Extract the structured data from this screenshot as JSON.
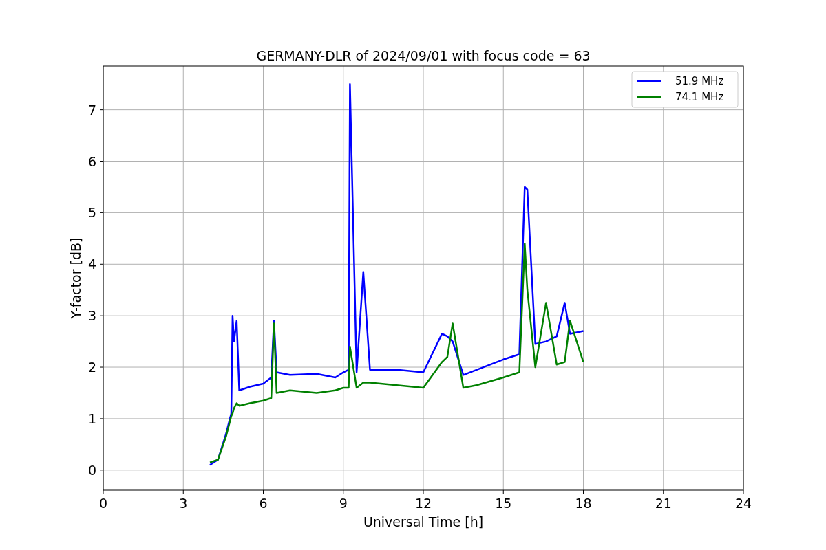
{
  "figure": {
    "chart_data": {
      "type": "line",
      "title": "GERMANY-DLR of 2024/09/01 with focus code = 63",
      "xlabel": "Universal Time [h]",
      "ylabel": "Y-factor [dB]",
      "xlim": [
        0,
        24
      ],
      "ylim": [
        -0.39,
        7.85
      ],
      "grid": true,
      "legend": true,
      "xticks": [
        0,
        3,
        6,
        9,
        12,
        15,
        18,
        21,
        24
      ],
      "yticks": [
        0,
        1,
        2,
        3,
        4,
        5,
        6,
        7
      ],
      "x": [
        4.0,
        4.3,
        4.6,
        4.8,
        4.85,
        4.9,
        5.0,
        5.1,
        5.5,
        6.0,
        6.3,
        6.4,
        6.5,
        7.0,
        8.0,
        8.7,
        9.0,
        9.2,
        9.25,
        9.5,
        9.75,
        10,
        11,
        12,
        12.7,
        12.9,
        13.1,
        13.5,
        14,
        15,
        15.6,
        15.8,
        15.9,
        16.2,
        16.6,
        17,
        17.3,
        17.5,
        18
      ],
      "series": [
        {
          "name": "51.9 MHz",
          "color": "#0000ff",
          "values": [
            0.1,
            0.2,
            0.7,
            1.1,
            3.0,
            2.5,
            2.9,
            1.55,
            1.62,
            1.68,
            1.8,
            2.9,
            1.9,
            1.85,
            1.87,
            1.8,
            1.9,
            1.95,
            7.5,
            1.9,
            3.85,
            1.95,
            1.95,
            1.9,
            2.65,
            2.6,
            2.5,
            1.85,
            1.95,
            2.15,
            2.25,
            5.5,
            5.45,
            2.45,
            2.5,
            2.6,
            3.25,
            2.65,
            2.7
          ]
        },
        {
          "name": "74.1 MHz",
          "color": "#008000",
          "values": [
            0.15,
            0.2,
            0.65,
            1.05,
            1.1,
            1.2,
            1.3,
            1.25,
            1.3,
            1.35,
            1.4,
            2.85,
            1.5,
            1.55,
            1.5,
            1.55,
            1.6,
            1.6,
            2.4,
            1.6,
            1.7,
            1.7,
            1.65,
            1.6,
            2.1,
            2.2,
            2.85,
            1.6,
            1.65,
            1.8,
            1.9,
            4.4,
            3.5,
            2.0,
            3.25,
            2.05,
            2.1,
            2.9,
            2.1
          ]
        }
      ]
    }
  }
}
